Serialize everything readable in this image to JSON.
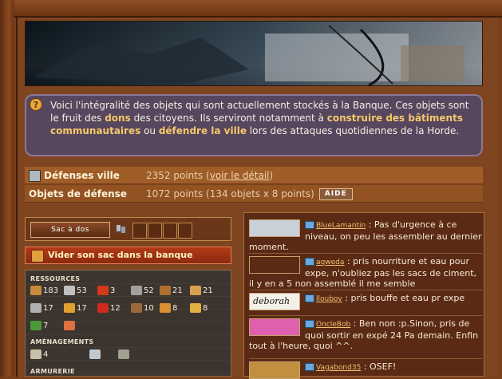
{
  "intro": {
    "t1": "Voici l'intégralité des objets qui sont actuellement stockés à la Banque. Ces objets sont le fruit des ",
    "dons": "dons",
    "t2": " des citoyens. Ils serviront notamment à ",
    "construire": "construire des bâtiments communautaires",
    "t3": " ou ",
    "defendre": "défendre la ville",
    "t4": " lors des attaques quotidiennes de la Horde."
  },
  "stats": {
    "defense_label": "Défenses ville",
    "defense_value": "2352 points (",
    "defense_link": "voir le détail",
    "defense_close": ")",
    "objects_label": "Objets de défense",
    "objects_value": "1072 points (134 objets x 8 points)",
    "help_button": "AIDE"
  },
  "bag": {
    "button_label": "Sac à dos",
    "empty_button_label": "Vider son sac dans la banque"
  },
  "stock": {
    "sections": {
      "resources": "RESSOURCES",
      "amenities": "AMÉNAGEMENTS",
      "armory": "ARMURERIE"
    },
    "resources": [
      {
        "icon": "plank-icon",
        "count": "183",
        "color": "#c88a3a"
      },
      {
        "icon": "scrap-icon",
        "count": "53",
        "color": "#c0c0c0"
      },
      {
        "icon": "battery-icon",
        "count": "3",
        "color": "#d03a1a"
      },
      {
        "icon": "metal-icon",
        "count": "52",
        "color": "#a0a0a0"
      },
      {
        "icon": "wood-beam-icon",
        "count": "21",
        "color": "#b07030"
      },
      {
        "icon": "tube-icon",
        "count": "21",
        "color": "#d8a050"
      },
      {
        "icon": "bolt-icon",
        "count": "17",
        "color": "#b0b0b0"
      },
      {
        "icon": "cement-icon",
        "count": "17",
        "color": "#e0a030"
      },
      {
        "icon": "can-icon",
        "count": "12",
        "color": "#d02a1a"
      },
      {
        "icon": "frame-icon",
        "count": "10",
        "color": "#9a6a3a"
      },
      {
        "icon": "box-icon",
        "count": "8",
        "color": "#d89030"
      },
      {
        "icon": "cable-icon",
        "count": "8",
        "color": "#e0b040"
      },
      {
        "icon": "plant-icon",
        "count": "7",
        "color": "#4a9a3a"
      },
      {
        "icon": "hook-icon",
        "count": "",
        "color": "#e07040"
      }
    ],
    "amenities": [
      {
        "icon": "sheet-icon",
        "count": "4",
        "color": "#c8c0a8"
      },
      {
        "icon": "tool-icon",
        "count": "",
        "color": "#c0c8d0"
      },
      {
        "icon": "grid-icon",
        "count": "",
        "color": "#a0a090"
      }
    ]
  },
  "chat": {
    "messages": [
      {
        "user": "BlueLamantin",
        "text": "Pas d'urgence à ce niveau, on peu les assembler au dernier moment.",
        "avatar_color": "#c8d0d8"
      },
      {
        "user": "aqweda",
        "text": "pris nourriture et eau pour expe, n'oubliez pas les sacs de ciment, il y en a 5 non assemblé il me semble",
        "avatar_color": "#5a2a14"
      },
      {
        "user": "lloubov",
        "text": "pris bouffe et eau pr expe",
        "avatar_color": "#f4f0e8",
        "avatar_text": "deborah"
      },
      {
        "user": "OncleBob",
        "text": "Ben non :p.Sinon, pris de quoi sortir en expé 24 Pa demain. Enfin tout à l'heure, quoi ^^.",
        "avatar_color": "#e060b0"
      },
      {
        "user": "Vagabond35",
        "text": "OSEF!",
        "avatar_color": "#c09040"
      }
    ]
  }
}
